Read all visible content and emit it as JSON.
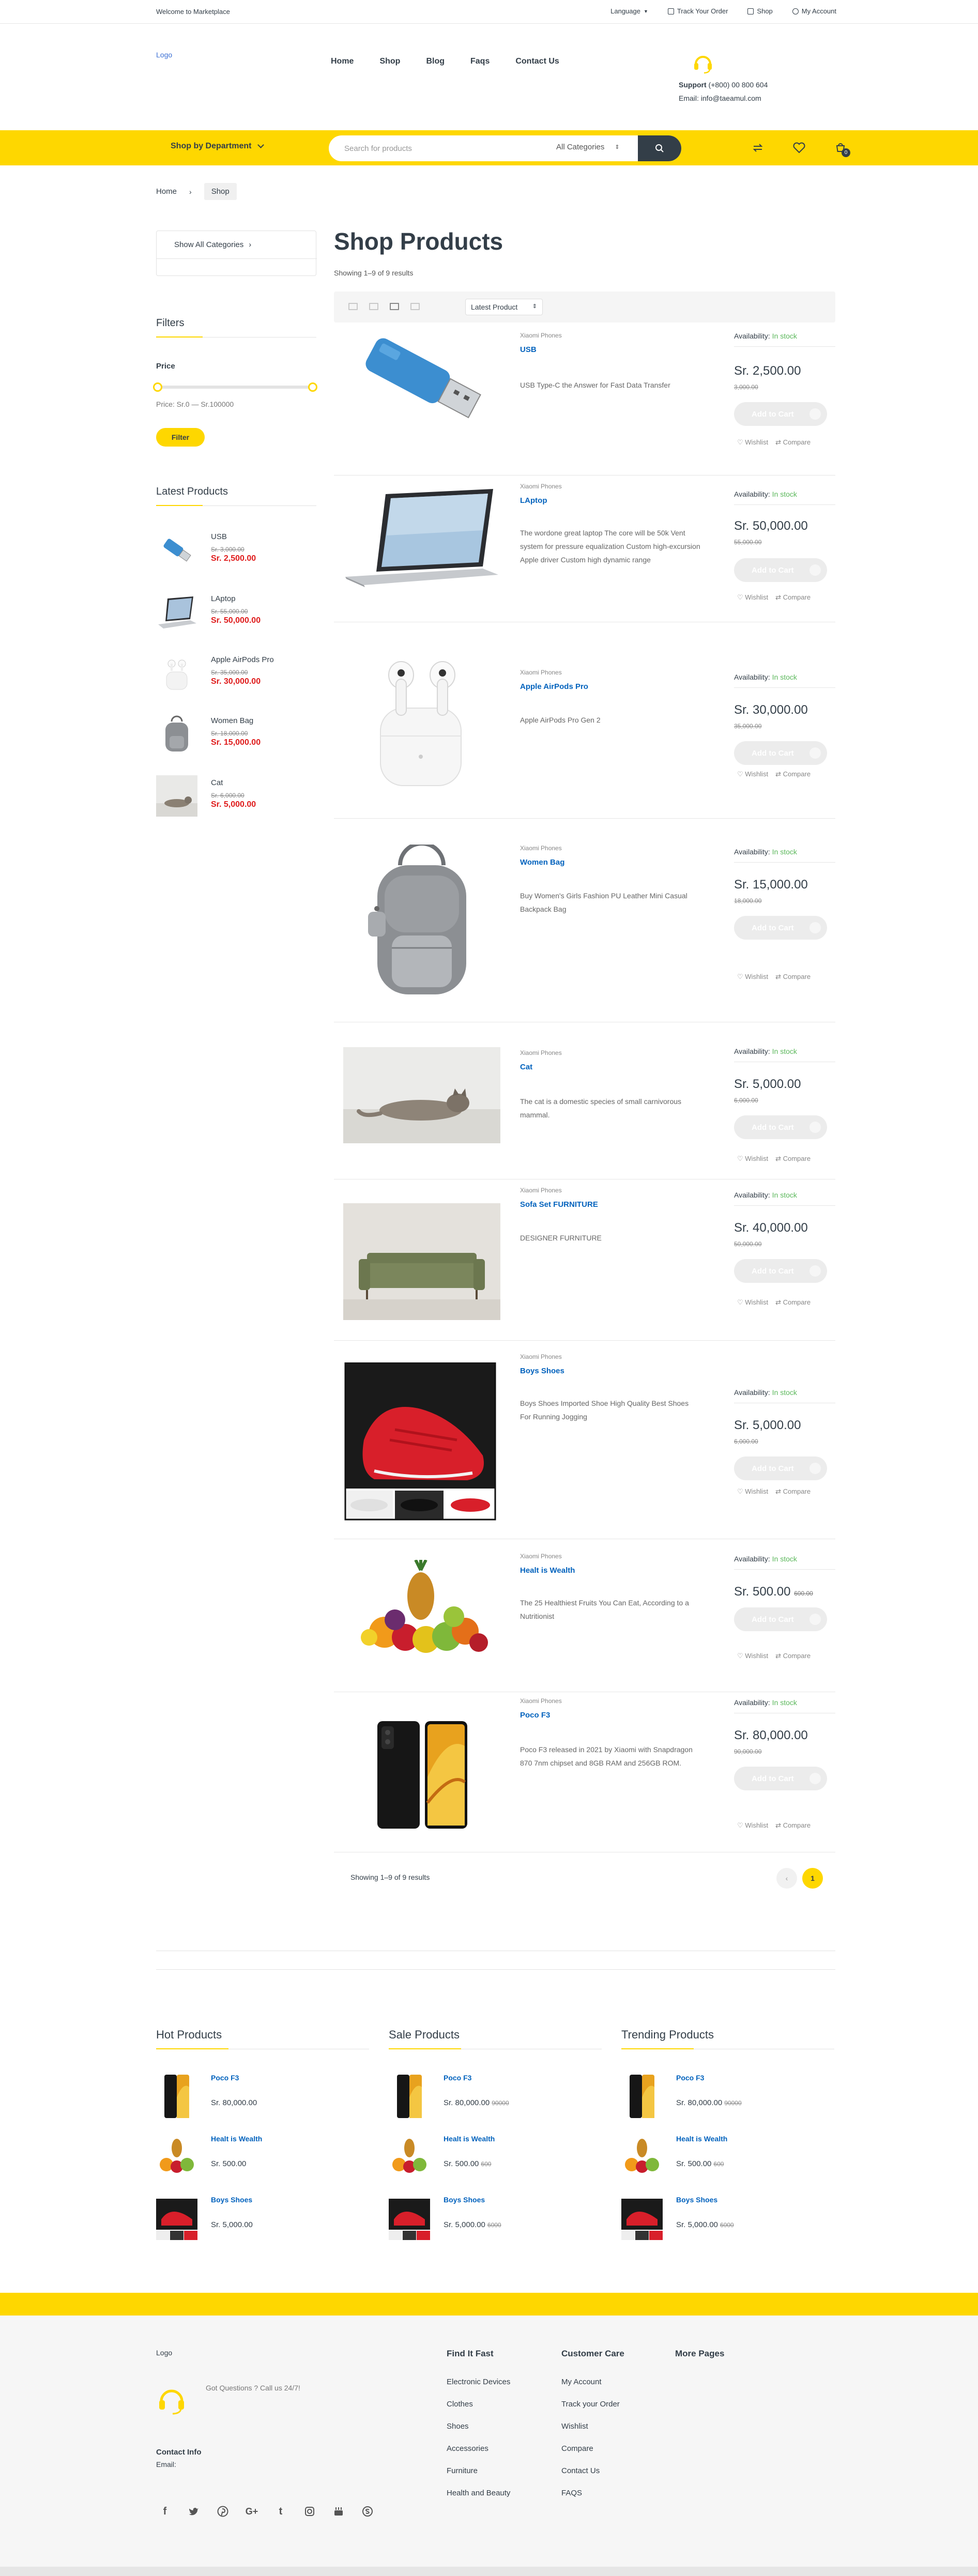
{
  "topbar": {
    "welcome": "Welcome to Marketplace",
    "language": "Language",
    "track": "Track Your Order",
    "shop": "Shop",
    "account": "My Account"
  },
  "header": {
    "logo": "Logo",
    "nav": [
      "Home",
      "Shop",
      "Blog",
      "Faqs",
      "Contact Us"
    ],
    "support_label": "Support",
    "support_phone": "(+800) 00 800 604",
    "email": "Email: info@taeamul.com"
  },
  "searchbar": {
    "department": "Shop by Department",
    "placeholder": "Search for products",
    "category": "All Categories",
    "cart_count": "0"
  },
  "breadcrumb": [
    "Home",
    "Shop"
  ],
  "sidebar": {
    "all_categories": "Show All Categories",
    "filters_title": "Filters",
    "price_label": "Price",
    "price_range": "Price: Sr.0 — Sr.100000",
    "filter_button": "Filter",
    "latest_title": "Latest Products",
    "latest": [
      {
        "name": "USB",
        "old": "Sr. 3,000.00",
        "new": "Sr. 2,500.00"
      },
      {
        "name": "LAptop",
        "old": "Sr. 55,000.00",
        "new": "Sr. 50,000.00"
      },
      {
        "name": "Apple AirPods Pro",
        "old": "Sr. 35,000.00",
        "new": "Sr. 30,000.00"
      },
      {
        "name": "Women Bag",
        "old": "Sr. 18,000.00",
        "new": "Sr. 15,000.00"
      },
      {
        "name": "Cat",
        "old": "Sr. 6,000.00",
        "new": "Sr. 5,000.00"
      }
    ]
  },
  "main": {
    "title": "Shop Products",
    "showing": "Showing 1–9 of 9 results",
    "sort": "Latest Product",
    "availability_label": "Availability:",
    "in_stock": "In stock",
    "add_to_cart": "Add to Cart",
    "wishlist": "Wishlist",
    "compare": "Compare",
    "products": [
      {
        "brand": "Xiaomi Phones",
        "name": "USB",
        "desc": "USB Type-C the Answer for Fast Data Transfer",
        "price": "Sr. 2,500.00",
        "old": "3,000.00",
        "icon": "usb-image"
      },
      {
        "brand": "Xiaomi Phones",
        "name": "LAptop",
        "desc": "The wordone great laptop The core will be 50k Vent system for pressure equalization Custom high-excursion Apple driver Custom high dynamic range",
        "price": "Sr. 50,000.00",
        "old": "55,000.00",
        "icon": "laptop-image"
      },
      {
        "brand": "Xiaomi Phones",
        "name": "Apple AirPods Pro",
        "desc": "Apple AirPods Pro Gen 2",
        "price": "Sr. 30,000.00",
        "old": "35,000.00",
        "icon": "airpods-image"
      },
      {
        "brand": "Xiaomi Phones",
        "name": "Women Bag",
        "desc": "Buy Women's Girls Fashion PU Leather Mini Casual Backpack Bag",
        "price": "Sr. 15,000.00",
        "old": "18,000.00",
        "icon": "bag-image"
      },
      {
        "brand": "Xiaomi Phones",
        "name": "Cat",
        "desc": "The cat is a domestic species of small carnivorous mammal.",
        "price": "Sr. 5,000.00",
        "old": "6,000.00",
        "icon": "cat-image"
      },
      {
        "brand": "Xiaomi Phones",
        "name": "Sofa Set FURNITURE",
        "desc": "DESIGNER FURNITURE",
        "price": "Sr. 40,000.00",
        "old": "50,000.00",
        "icon": "sofa-image"
      },
      {
        "brand": "Xiaomi Phones",
        "name": "Boys Shoes",
        "desc": "Boys Shoes Imported Shoe High Quality Best Shoes For Running Jogging",
        "price": "Sr. 5,000.00",
        "old": "6,000.00",
        "icon": "shoes-image"
      },
      {
        "brand": "Xiaomi Phones",
        "name": "Healt is Wealth",
        "desc": "The 25 Healthiest Fruits You Can Eat, According to a Nutritionist",
        "price": "Sr. 500.00",
        "old": "600.00",
        "icon": "fruits-image"
      },
      {
        "brand": "Xiaomi Phones",
        "name": "Poco F3",
        "desc": "Poco F3 released in 2021 by Xiaomi with Snapdragon 870 7nm chipset and 8GB RAM and 256GB ROM.",
        "price": "Sr. 80,000.00",
        "old": "90,000.00",
        "icon": "phone-image"
      }
    ],
    "pager_text": "Showing 1–9 of 9 results",
    "pager_prev": "‹",
    "pager_page": "1"
  },
  "bottom_lists": [
    {
      "title": "Hot Products",
      "items": [
        {
          "name": "Poco F3",
          "price": "Sr. 80,000.00",
          "old": ""
        },
        {
          "name": "Healt is Wealth",
          "price": "Sr. 500.00",
          "old": ""
        },
        {
          "name": "Boys Shoes",
          "price": "Sr. 5,000.00",
          "old": ""
        }
      ]
    },
    {
      "title": "Sale Products",
      "items": [
        {
          "name": "Poco F3",
          "price": "Sr. 80,000.00",
          "old": "90000"
        },
        {
          "name": "Healt is Wealth",
          "price": "Sr. 500.00",
          "old": "600"
        },
        {
          "name": "Boys Shoes",
          "price": "Sr. 5,000.00",
          "old": "6000"
        }
      ]
    },
    {
      "title": "Trending Products",
      "items": [
        {
          "name": "Poco F3",
          "price": "Sr. 80,000.00",
          "old": "90000"
        },
        {
          "name": "Healt is Wealth",
          "price": "Sr. 500.00",
          "old": "600"
        },
        {
          "name": "Boys Shoes",
          "price": "Sr. 5,000.00",
          "old": "6000"
        }
      ]
    }
  ],
  "footer": {
    "logo": "Logo",
    "questions": "Got Questions ? Call us 24/7!",
    "contact_info": "Contact Info",
    "email": "Email:",
    "col1_title": "Find It Fast",
    "col1": [
      "Electronic Devices",
      "Clothes",
      "Shoes",
      "Accessories",
      "Furniture",
      "Health and Beauty"
    ],
    "col2_title": "Customer Care",
    "col2": [
      "My Account",
      "Track your Order",
      "Wishlist",
      "Compare",
      "Contact Us",
      "FAQS"
    ],
    "col3_title": "More Pages",
    "social": [
      "facebook-icon",
      "twitter-icon",
      "pinterest-icon",
      "google-plus-icon",
      "tumblr-icon",
      "instagram-icon",
      "youtube-icon",
      "skype-icon"
    ]
  },
  "colors": {
    "accent": "#fed700",
    "dark": "#333e48",
    "link": "#0062bd",
    "sale": "#df1b1b",
    "stock": "#5cb85c"
  }
}
